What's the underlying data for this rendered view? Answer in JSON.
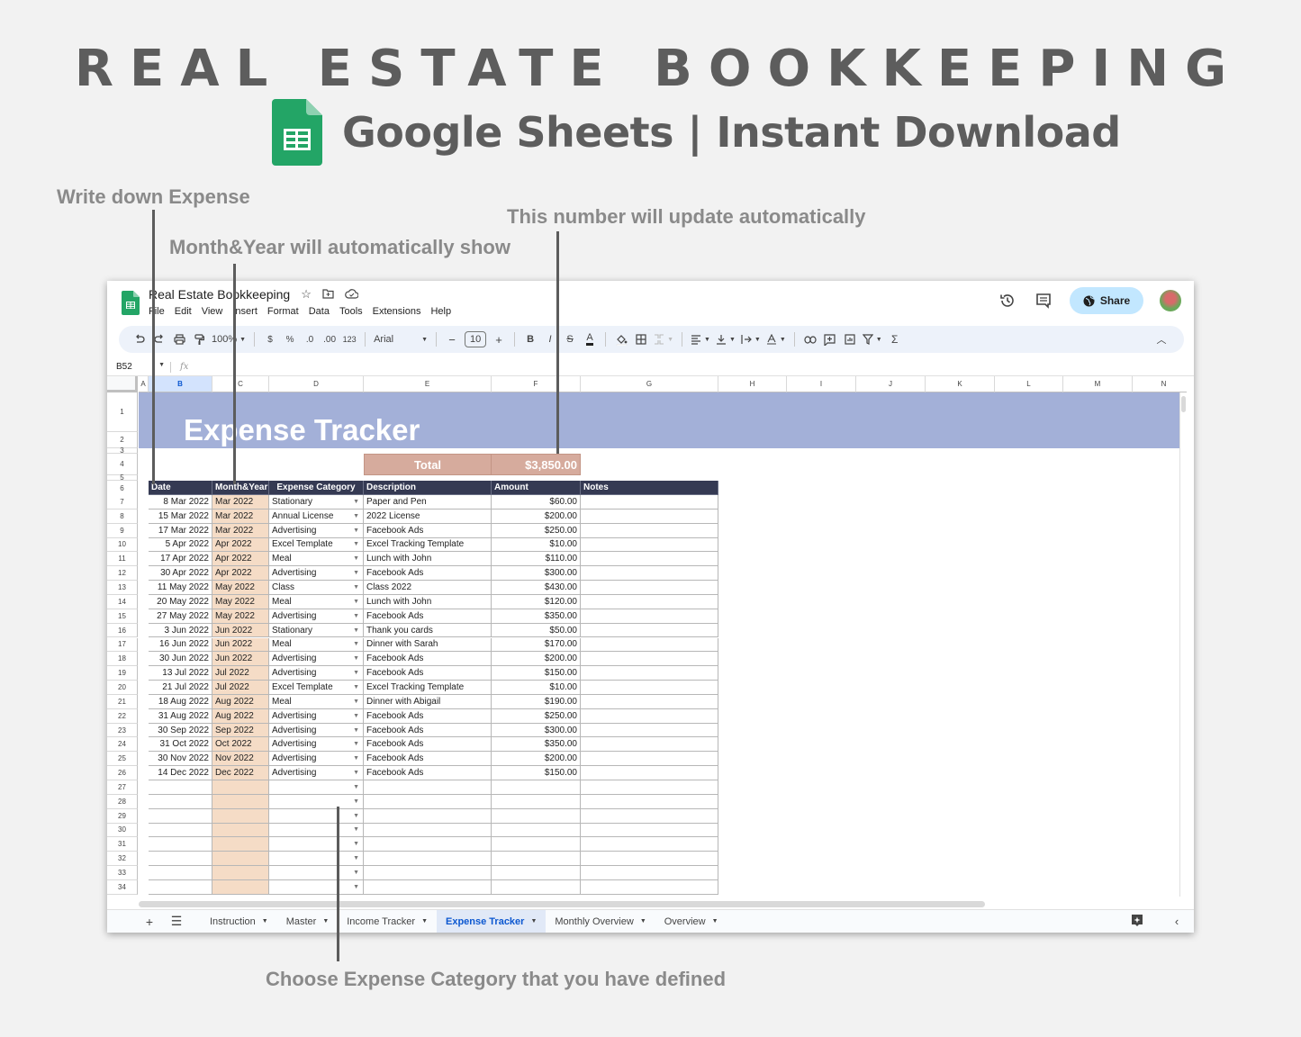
{
  "hero": {
    "title": "REAL ESTATE BOOKKEEPING",
    "subtitle": "Google Sheets | Instant Download"
  },
  "annotations": {
    "write_expense": "Write down Expense",
    "month_year": "Month&Year will automatically show",
    "auto_update": "This number will update automatically",
    "choose_category": "Choose Expense Category that you have defined"
  },
  "app": {
    "doc_title": "Real Estate Bookkeeping",
    "menu": [
      "File",
      "Edit",
      "View",
      "Insert",
      "Format",
      "Data",
      "Tools",
      "Extensions",
      "Help"
    ],
    "share_label": "Share",
    "toolbar": {
      "zoom": "100%",
      "currency": "$",
      "percent": "%",
      "dec_decrease": ".0",
      "dec_increase": ".00",
      "number_format": "123",
      "font": "Arial",
      "font_size": "10",
      "bold": "B",
      "italic": "I",
      "text_color": "A",
      "minus": "−",
      "plus": "+"
    },
    "name_box": "B52",
    "fx": "fx"
  },
  "grid": {
    "columns": [
      "A",
      "B",
      "C",
      "D",
      "E",
      "F",
      "G",
      "H",
      "I",
      "J",
      "K",
      "L",
      "M",
      "N"
    ],
    "selected_column": "B",
    "banner_title": "Expense Tracker",
    "total_label": "Total",
    "total_value": "$3,850.00",
    "headers": [
      "Date",
      "Month&Year",
      "Expense Category",
      "Description",
      "Amount",
      "Notes"
    ],
    "rows": [
      {
        "row": "7",
        "date": "8 Mar 2022",
        "month": "Mar 2022",
        "category": "Stationary",
        "description": "Paper and Pen",
        "amount": "$60.00"
      },
      {
        "row": "8",
        "date": "15 Mar 2022",
        "month": "Mar 2022",
        "category": "Annual License",
        "description": "2022 License",
        "amount": "$200.00"
      },
      {
        "row": "9",
        "date": "17 Mar 2022",
        "month": "Mar 2022",
        "category": "Advertising",
        "description": "Facebook Ads",
        "amount": "$250.00"
      },
      {
        "row": "10",
        "date": "5 Apr 2022",
        "month": "Apr 2022",
        "category": "Excel Template",
        "description": "Excel Tracking Template",
        "amount": "$10.00"
      },
      {
        "row": "11",
        "date": "17 Apr 2022",
        "month": "Apr 2022",
        "category": "Meal",
        "description": "Lunch with John",
        "amount": "$110.00"
      },
      {
        "row": "12",
        "date": "30 Apr 2022",
        "month": "Apr 2022",
        "category": "Advertising",
        "description": "Facebook Ads",
        "amount": "$300.00"
      },
      {
        "row": "13",
        "date": "11 May 2022",
        "month": "May 2022",
        "category": "Class",
        "description": "Class 2022",
        "amount": "$430.00"
      },
      {
        "row": "14",
        "date": "20 May 2022",
        "month": "May 2022",
        "category": "Meal",
        "description": "Lunch with John",
        "amount": "$120.00"
      },
      {
        "row": "15",
        "date": "27 May 2022",
        "month": "May 2022",
        "category": "Advertising",
        "description": "Facebook Ads",
        "amount": "$350.00"
      },
      {
        "row": "16",
        "date": "3 Jun 2022",
        "month": "Jun 2022",
        "category": "Stationary",
        "description": "Thank you cards",
        "amount": "$50.00"
      },
      {
        "row": "17",
        "date": "16 Jun 2022",
        "month": "Jun 2022",
        "category": "Meal",
        "description": "Dinner with Sarah",
        "amount": "$170.00"
      },
      {
        "row": "18",
        "date": "30 Jun 2022",
        "month": "Jun 2022",
        "category": "Advertising",
        "description": "Facebook Ads",
        "amount": "$200.00"
      },
      {
        "row": "19",
        "date": "13 Jul 2022",
        "month": "Jul 2022",
        "category": "Advertising",
        "description": "Facebook Ads",
        "amount": "$150.00"
      },
      {
        "row": "20",
        "date": "21 Jul 2022",
        "month": "Jul 2022",
        "category": "Excel Template",
        "description": "Excel Tracking Template",
        "amount": "$10.00"
      },
      {
        "row": "21",
        "date": "18 Aug 2022",
        "month": "Aug 2022",
        "category": "Meal",
        "description": "Dinner with Abigail",
        "amount": "$190.00"
      },
      {
        "row": "22",
        "date": "31 Aug 2022",
        "month": "Aug 2022",
        "category": "Advertising",
        "description": "Facebook Ads",
        "amount": "$250.00"
      },
      {
        "row": "23",
        "date": "30 Sep 2022",
        "month": "Sep 2022",
        "category": "Advertising",
        "description": "Facebook Ads",
        "amount": "$300.00"
      },
      {
        "row": "24",
        "date": "31 Oct 2022",
        "month": "Oct 2022",
        "category": "Advertising",
        "description": "Facebook Ads",
        "amount": "$350.00"
      },
      {
        "row": "25",
        "date": "30 Nov 2022",
        "month": "Nov 2022",
        "category": "Advertising",
        "description": "Facebook Ads",
        "amount": "$200.00"
      },
      {
        "row": "26",
        "date": "14 Dec 2022",
        "month": "Dec 2022",
        "category": "Advertising",
        "description": "Facebook Ads",
        "amount": "$150.00"
      },
      {
        "row": "27",
        "date": "",
        "month": "",
        "category": "",
        "description": "",
        "amount": ""
      },
      {
        "row": "28",
        "date": "",
        "month": "",
        "category": "",
        "description": "",
        "amount": ""
      },
      {
        "row": "29",
        "date": "",
        "month": "",
        "category": "",
        "description": "",
        "amount": ""
      },
      {
        "row": "30",
        "date": "",
        "month": "",
        "category": "",
        "description": "",
        "amount": ""
      },
      {
        "row": "31",
        "date": "",
        "month": "",
        "category": "",
        "description": "",
        "amount": ""
      },
      {
        "row": "32",
        "date": "",
        "month": "",
        "category": "",
        "description": "",
        "amount": ""
      },
      {
        "row": "33",
        "date": "",
        "month": "",
        "category": "",
        "description": "",
        "amount": ""
      },
      {
        "row": "34",
        "date": "",
        "month": "",
        "category": "",
        "description": "",
        "amount": ""
      }
    ],
    "top_rows": [
      "1",
      "2",
      "3",
      "4",
      "5",
      "6"
    ]
  },
  "sheet_tabs": [
    {
      "label": "Instruction",
      "active": false
    },
    {
      "label": "Master",
      "active": false
    },
    {
      "label": "Income Tracker",
      "active": false
    },
    {
      "label": "Expense Tracker",
      "active": true
    },
    {
      "label": "Monthly Overview",
      "active": false
    },
    {
      "label": "Overview",
      "active": false
    }
  ],
  "colors": {
    "banner": "#a3b0d8",
    "header_row": "#353a53",
    "month_column": "#f5dcc6",
    "total_box": "#d6ab9d",
    "share_button": "#c2e7ff",
    "active_tab_text": "#0b57d0"
  }
}
